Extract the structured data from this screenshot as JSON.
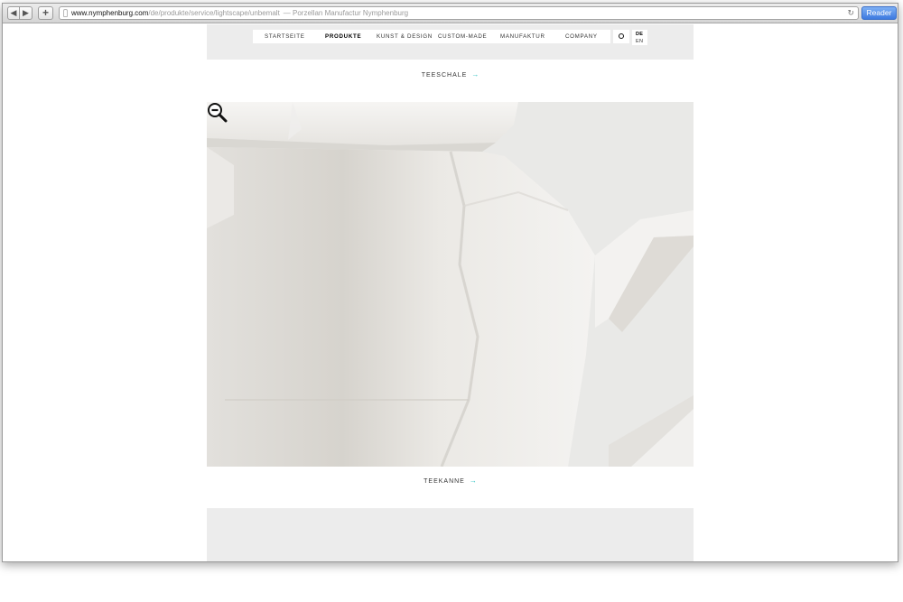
{
  "browser": {
    "back_glyph": "◀",
    "forward_glyph": "▶",
    "newtab_glyph": "+",
    "url_host": "www.nymphenburg.com",
    "url_path": "/de/produkte/service/lightscape/unbemalt",
    "page_title": "— Porzellan Manufactur Nymphenburg",
    "reload_glyph": "↻",
    "reader_label": "Reader"
  },
  "nav": {
    "items": [
      {
        "label": "STARTSEITE",
        "active": false
      },
      {
        "label": "PRODUKTE",
        "active": true
      },
      {
        "label": "KUNST & DESIGN",
        "active": false
      },
      {
        "label": "CUSTOM-MADE",
        "active": false
      },
      {
        "label": "MANUFAKTUR",
        "active": false
      },
      {
        "label": "COMPANY",
        "active": false
      }
    ],
    "search_icon": "search-icon",
    "languages": [
      {
        "label": "DE",
        "active": true
      },
      {
        "label": "EN",
        "active": false
      }
    ]
  },
  "gallery": {
    "caption_top": "TEESCHALE",
    "caption_main": "TEEKANNE",
    "arrow_glyph": "→",
    "arrow_color": "#36c4c4",
    "cursor_icon": "zoom-out-icon"
  }
}
